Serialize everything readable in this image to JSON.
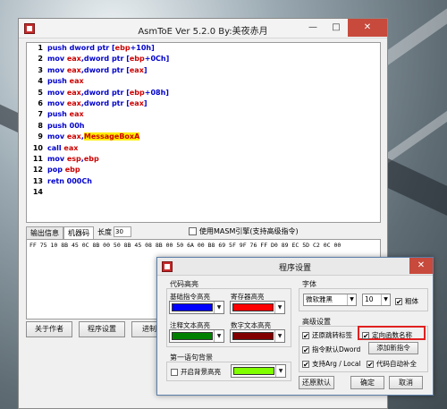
{
  "main_window": {
    "title": "AsmToE Ver 5.2.0  By:美夜赤月",
    "minimize_icon": "minimize-icon",
    "maximize_icon": "maximize-icon",
    "close_icon": "close-icon"
  },
  "code_lines": [
    {
      "n": "1",
      "parts": [
        {
          "t": "push dword ptr [",
          "c": "k"
        },
        {
          "t": "ebp",
          "c": "r"
        },
        {
          "t": "+10h]",
          "c": "k"
        }
      ]
    },
    {
      "n": "2",
      "parts": [
        {
          "t": "mov ",
          "c": "k"
        },
        {
          "t": "eax",
          "c": "r"
        },
        {
          "t": ",dword ptr [",
          "c": "k"
        },
        {
          "t": "ebp",
          "c": "r"
        },
        {
          "t": "+0Ch]",
          "c": "k"
        }
      ]
    },
    {
      "n": "3",
      "parts": [
        {
          "t": "mov ",
          "c": "k"
        },
        {
          "t": "eax",
          "c": "r"
        },
        {
          "t": ",dword ptr [",
          "c": "k"
        },
        {
          "t": "eax",
          "c": "r"
        },
        {
          "t": "]",
          "c": "k"
        }
      ]
    },
    {
      "n": "4",
      "parts": [
        {
          "t": "push ",
          "c": "k"
        },
        {
          "t": "eax",
          "c": "r"
        }
      ]
    },
    {
      "n": "5",
      "parts": [
        {
          "t": "mov ",
          "c": "k"
        },
        {
          "t": "eax",
          "c": "r"
        },
        {
          "t": ",dword ptr [",
          "c": "k"
        },
        {
          "t": "ebp",
          "c": "r"
        },
        {
          "t": "+08h]",
          "c": "k"
        }
      ]
    },
    {
      "n": "6",
      "parts": [
        {
          "t": "mov ",
          "c": "k"
        },
        {
          "t": "eax",
          "c": "r"
        },
        {
          "t": ",dword ptr [",
          "c": "k"
        },
        {
          "t": "eax",
          "c": "r"
        },
        {
          "t": "]",
          "c": "k"
        }
      ]
    },
    {
      "n": "7",
      "parts": [
        {
          "t": "push ",
          "c": "k"
        },
        {
          "t": "eax",
          "c": "r"
        }
      ]
    },
    {
      "n": "8",
      "parts": [
        {
          "t": "push 00h",
          "c": "k"
        }
      ]
    },
    {
      "n": "9",
      "parts": [
        {
          "t": "mov ",
          "c": "k"
        },
        {
          "t": "eax",
          "c": "r"
        },
        {
          "t": ",",
          "c": "k"
        },
        {
          "t": "MessageBoxA",
          "c": "h"
        }
      ]
    },
    {
      "n": "10",
      "parts": [
        {
          "t": "call ",
          "c": "k"
        },
        {
          "t": "eax",
          "c": "r"
        }
      ]
    },
    {
      "n": "11",
      "parts": [
        {
          "t": "mov ",
          "c": "k"
        },
        {
          "t": "esp",
          "c": "r"
        },
        {
          "t": ",",
          "c": "k"
        },
        {
          "t": "ebp",
          "c": "r"
        }
      ]
    },
    {
      "n": "12",
      "parts": [
        {
          "t": "pop ",
          "c": "k"
        },
        {
          "t": "ebp",
          "c": "r"
        }
      ]
    },
    {
      "n": "13",
      "parts": [
        {
          "t": "retn 000Ch",
          "c": "k"
        }
      ]
    },
    {
      "n": "14",
      "parts": []
    }
  ],
  "tabs": {
    "output": "输出信息",
    "machine_code": "机器码",
    "length_label": "长度",
    "length_value": "30"
  },
  "masm_checkbox": {
    "label": "使用MASM引擎(支持高级指令)",
    "checked": false
  },
  "hex_output": "FF 75 10 8B 45 0C 8B 00 50 8B 45 08 8B 00 50 6A 00 B8 69 5F 9F 76 FF D0 89 EC 5D C2 0C 00",
  "bottom_buttons": {
    "about": "关于作者",
    "settings": "程序设置",
    "third": "进制"
  },
  "settings_dialog": {
    "title": "程序设置",
    "code_highlight": {
      "group": "代码高亮",
      "basic_label": "基础指令高亮",
      "basic_color": "#0000ff",
      "register_label": "寄存器高亮",
      "register_color": "#ff0000",
      "comment_label": "注释文本高亮",
      "comment_color": "#008000",
      "number_label": "数字文本高亮",
      "number_color": "#800000"
    },
    "first_line_bg": {
      "group": "第一语句背景",
      "checkbox_label": "开启背景高亮",
      "checked": false,
      "color": "#80ff00"
    },
    "font": {
      "group": "字体",
      "name": "微软雅黑",
      "size": "10",
      "bold_label": "粗体",
      "bold_checked": true
    },
    "advanced": {
      "group": "高级设置",
      "restore_jump_labels": {
        "label": "还原跳转标签",
        "checked": true
      },
      "locate_function_names": {
        "label": "定向函数名称",
        "checked": true
      },
      "default_dword": {
        "label": "指令默认Dword",
        "checked": true
      },
      "add_instruction_button": "添加新指令",
      "support_arg_local": {
        "label": "支持Arg / Local",
        "checked": true
      },
      "code_autocomplete": {
        "label": "代码自动补全",
        "checked": true
      }
    },
    "buttons": {
      "restore_defaults": "还原默认",
      "ok": "确定",
      "cancel": "取消"
    }
  }
}
